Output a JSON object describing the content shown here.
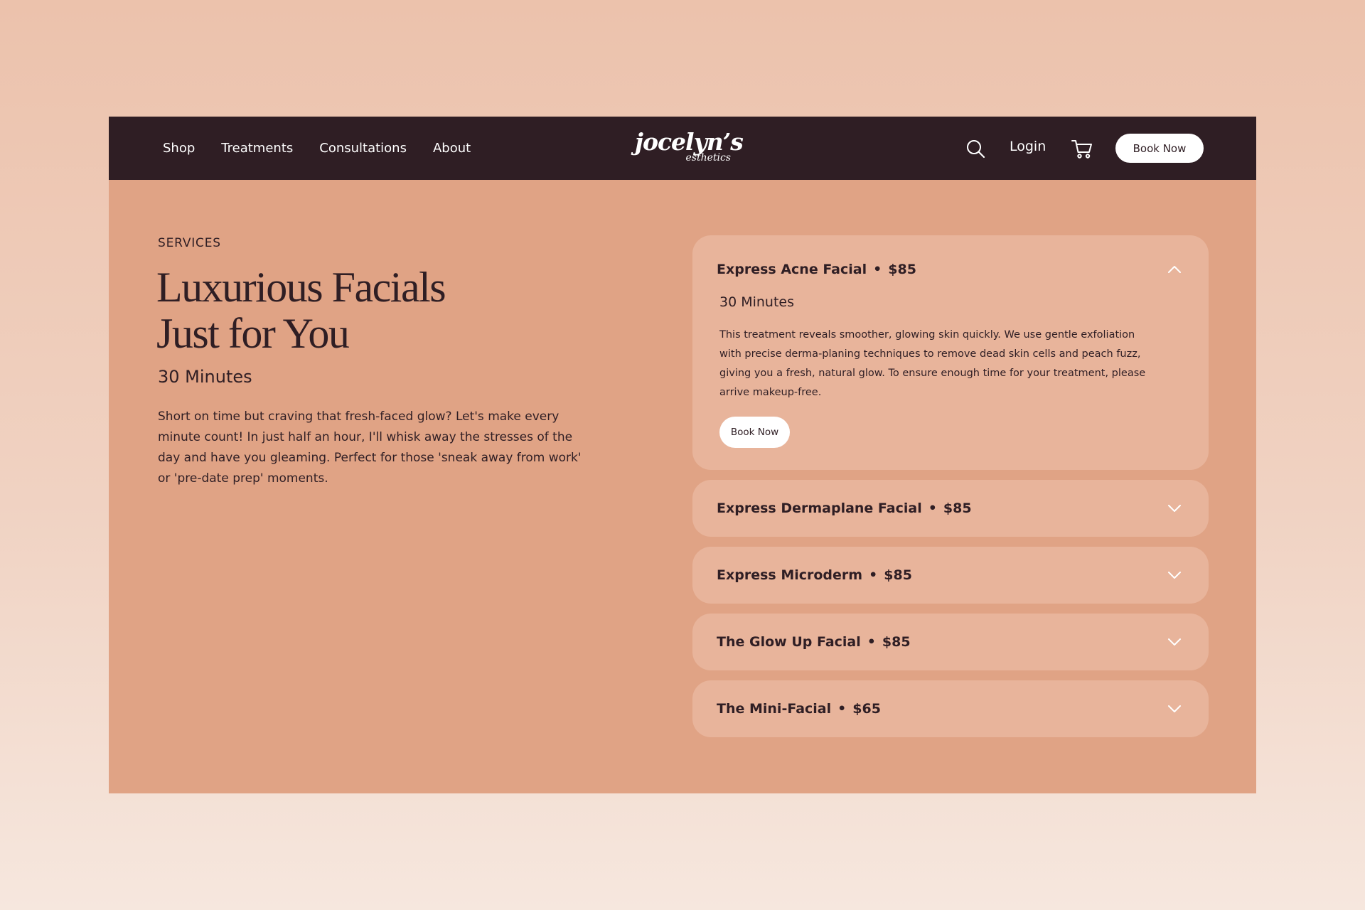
{
  "colors": {
    "nav_background": "#2f1e24",
    "panel_background": "#e0a385",
    "card_background": "#e8b49b",
    "text_dark": "#2f1e24",
    "button_white": "#ffffff"
  },
  "nav": {
    "links": [
      "Shop",
      "Treatments",
      "Consultations",
      "About"
    ],
    "logo_main": "jocelyn’s",
    "logo_sub": "esthetics",
    "login_label": "Login",
    "book_now_label": "Book Now",
    "icons": [
      "search-icon",
      "cart-icon"
    ]
  },
  "hero": {
    "eyebrow": "SERVICES",
    "title_line1": "Luxurious Facials",
    "title_line2": "Just for You",
    "duration": "30 Minutes",
    "description": "Short on time but craving that fresh-faced glow? Let's make every minute count! In just half an hour, I'll whisk away the stresses of the day and have you gleaming. Perfect for those 'sneak away from work' or 'pre-date prep' moments."
  },
  "services": [
    {
      "name": "Express Acne Facial",
      "separator": "•",
      "price": "$85",
      "expanded": true,
      "duration": "30 Minutes",
      "description": "This treatment reveals smoother, glowing skin quickly. We use gentle exfoliation with precise derma-planing techniques to remove dead skin cells and peach fuzz, giving you a fresh, natural glow. To ensure enough time for your treatment, please arrive makeup-free.",
      "button_label": "Book Now",
      "icon": "chevron-up-icon"
    },
    {
      "name": "Express Dermaplane Facial",
      "separator": "•",
      "price": "$85",
      "expanded": false,
      "icon": "chevron-down-icon"
    },
    {
      "name": "Express Microderm",
      "separator": "•",
      "price": "$85",
      "expanded": false,
      "icon": "chevron-down-icon"
    },
    {
      "name": "The Glow Up Facial",
      "separator": "•",
      "price": "$85",
      "expanded": false,
      "icon": "chevron-down-icon"
    },
    {
      "name": "The Mini-Facial",
      "separator": "•",
      "price": "$65",
      "expanded": false,
      "icon": "chevron-down-icon"
    }
  ]
}
